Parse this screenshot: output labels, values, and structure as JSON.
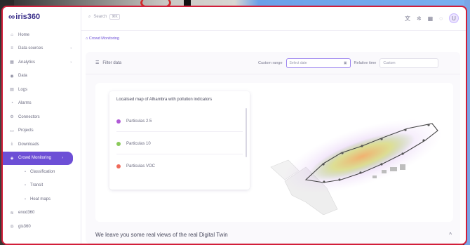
{
  "app": {
    "logo_text": "iris360",
    "logo_mark": "∞"
  },
  "topbar": {
    "search_placeholder": "Search",
    "search_shortcut": "⌘K",
    "icons": [
      "translate-icon",
      "settings-icon",
      "grid-icon",
      "bell-icon"
    ],
    "avatar_initial": "U"
  },
  "sidebar": {
    "items": [
      {
        "label": "Home",
        "icon": "⌂"
      },
      {
        "label": "Data sources",
        "icon": "≡",
        "chevron": "›"
      },
      {
        "label": "Analytics",
        "icon": "▦",
        "chevron": "›"
      },
      {
        "label": "Data",
        "icon": "◉"
      },
      {
        "label": "Logs",
        "icon": "▤"
      },
      {
        "label": "Alarms",
        "icon": "◔"
      },
      {
        "label": "Connectors",
        "icon": "⚙"
      },
      {
        "label": "Projects",
        "icon": "▭"
      },
      {
        "label": "Downloads",
        "icon": "⤓"
      },
      {
        "label": "Crowd Monitoring",
        "icon": "◈",
        "chevron": "›",
        "active": true
      },
      {
        "label": "Classification",
        "icon": "•",
        "sub": true
      },
      {
        "label": "Transit",
        "icon": "•",
        "sub": true
      },
      {
        "label": "Heat maps",
        "icon": "•",
        "sub": true
      },
      {
        "label": "enod360",
        "icon": "≋"
      },
      {
        "label": "gis360",
        "icon": "◎"
      }
    ]
  },
  "breadcrumb": "Crowd Monitoring",
  "filters": {
    "label": "Filter data",
    "custom_range_label": "Custom range",
    "date_placeholder": "Select date",
    "relative_time_label": "Relative time",
    "relative_time_value": "Custom"
  },
  "legend": {
    "title": "Localised map of Alhambra with pollution indicators",
    "items": [
      {
        "label": "Particulas 2.5",
        "color": "#b05ad6"
      },
      {
        "label": "Particulas 10",
        "color": "#8ac95a"
      },
      {
        "label": "Particulas VOC",
        "color": "#ef6a5a"
      }
    ]
  },
  "bottom": {
    "text": "We leave you some real views of the real Digital Twin",
    "caret": "^"
  }
}
